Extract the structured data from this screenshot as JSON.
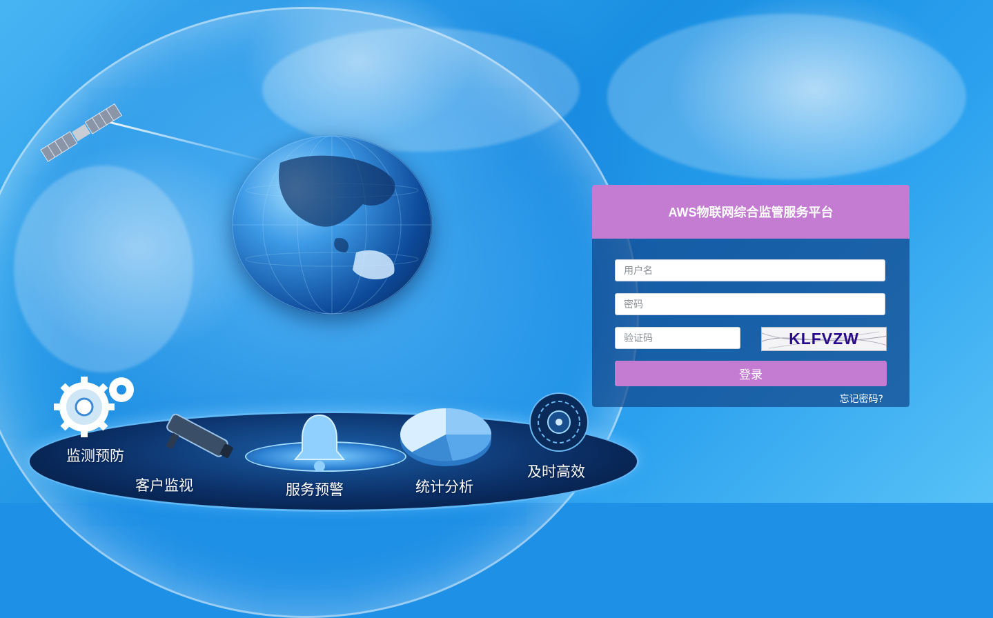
{
  "login": {
    "title": "AWS物联网综合监管服务平台",
    "username_placeholder": "用户名",
    "password_placeholder": "密码",
    "captcha_placeholder": "验证码",
    "captcha_text": "KLFVZW",
    "submit_label": "登录",
    "forgot_link": "忘记密码?"
  },
  "features": [
    {
      "label": "监测预防",
      "icon": "gear-icon"
    },
    {
      "label": "客户监视",
      "icon": "camera-icon"
    },
    {
      "label": "服务预警",
      "icon": "bell-icon"
    },
    {
      "label": "统计分析",
      "icon": "pie-chart-icon"
    },
    {
      "label": "及时高效",
      "icon": "dial-icon"
    }
  ],
  "colors": {
    "accent": "#c47cd2",
    "panel": "#10468c",
    "background": "#1e90e6"
  }
}
